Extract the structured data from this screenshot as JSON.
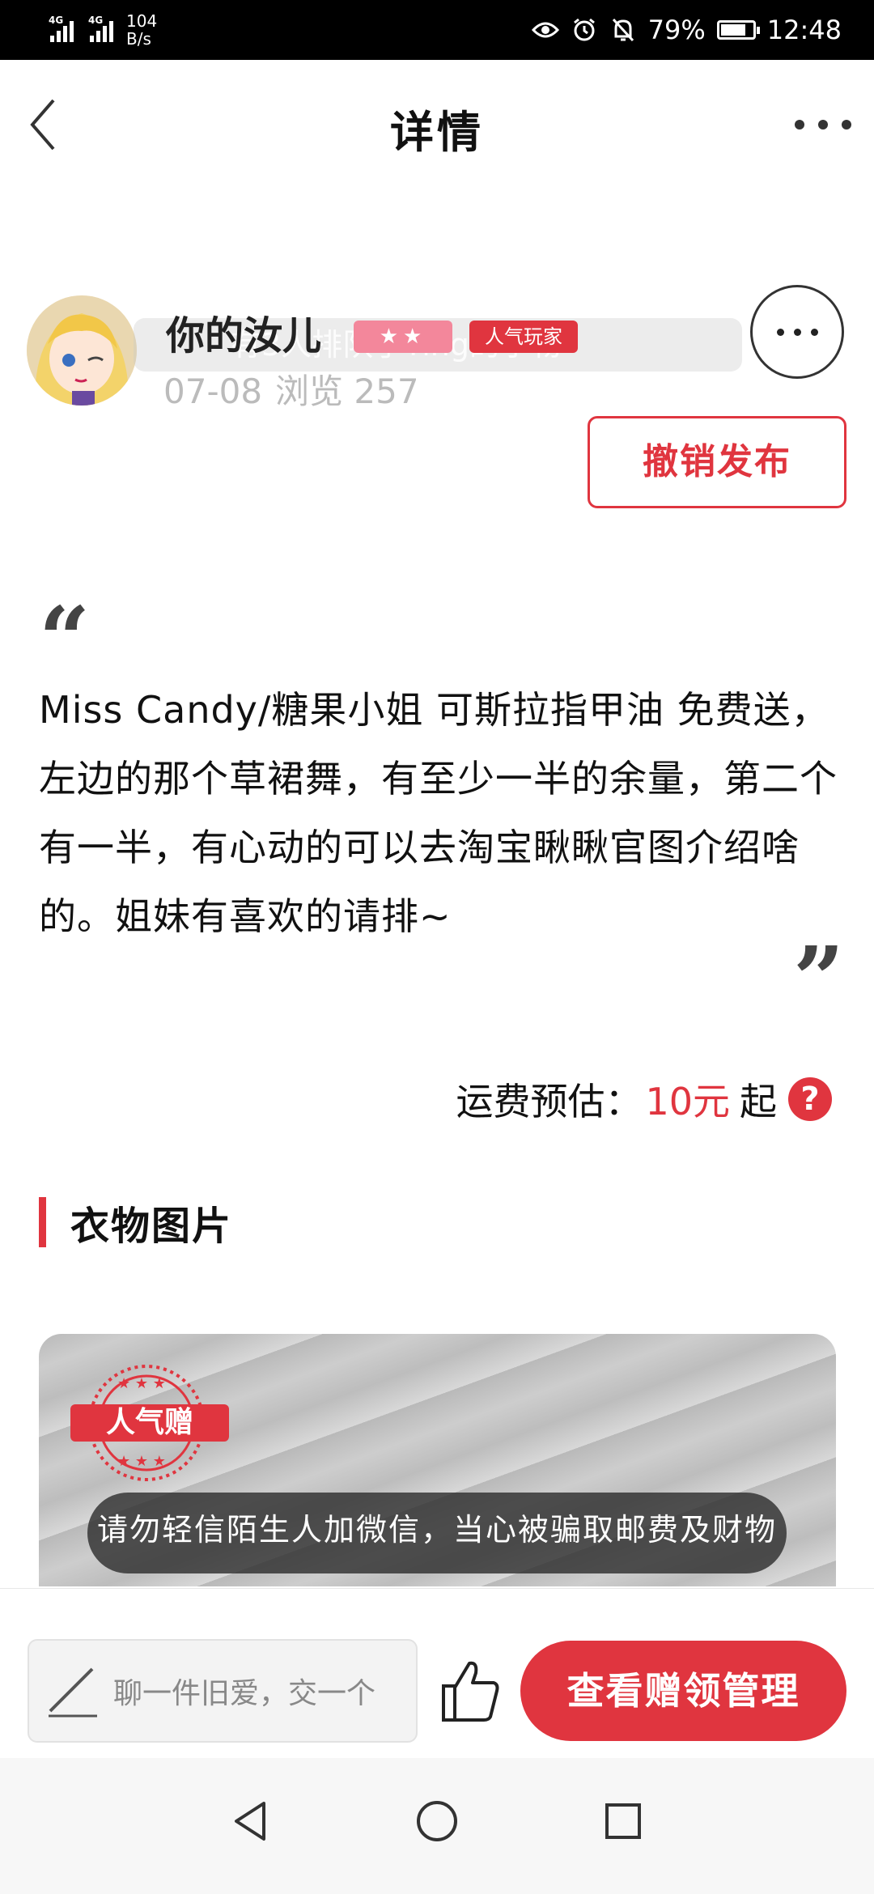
{
  "status_bar": {
    "signal1": "4G",
    "signal2": "4G",
    "net_speed_value": "104",
    "net_speed_unit": "B/s",
    "battery": "79%",
    "battery_level": 0.79,
    "time": "12:48"
  },
  "header": {
    "title": "详情"
  },
  "post": {
    "username": "你的汝儿",
    "stars_badge": "★★",
    "popular_badge": "人气玩家",
    "date": "07-08",
    "views_label": "浏览 257",
    "ghost_banner": "有3人排队了Ting的小物",
    "revoke_label": "撤销发布",
    "description": "Miss Candy/糖果小姐 可斯拉指甲油 免费送，左边的那个草裙舞，有至少一半的余量，第二个有一半，有心动的可以去淘宝瞅瞅官图介绍啥的。姐妹有喜欢的请排~",
    "shipping_label": "运费预估：",
    "shipping_price": "10元",
    "shipping_suffix": "起",
    "help_symbol": "?"
  },
  "section": {
    "title": "衣物图片"
  },
  "photo": {
    "stamp_text": "人气赠",
    "warning": "请勿轻信陌生人加微信，当心被骗取邮费及财物"
  },
  "bottom_bar": {
    "comment_placeholder": "聊一件旧爱，交一个",
    "manage_label": "查看赠领管理"
  },
  "colors": {
    "accent": "#e0353f",
    "badge_pink": "#f3879b"
  }
}
